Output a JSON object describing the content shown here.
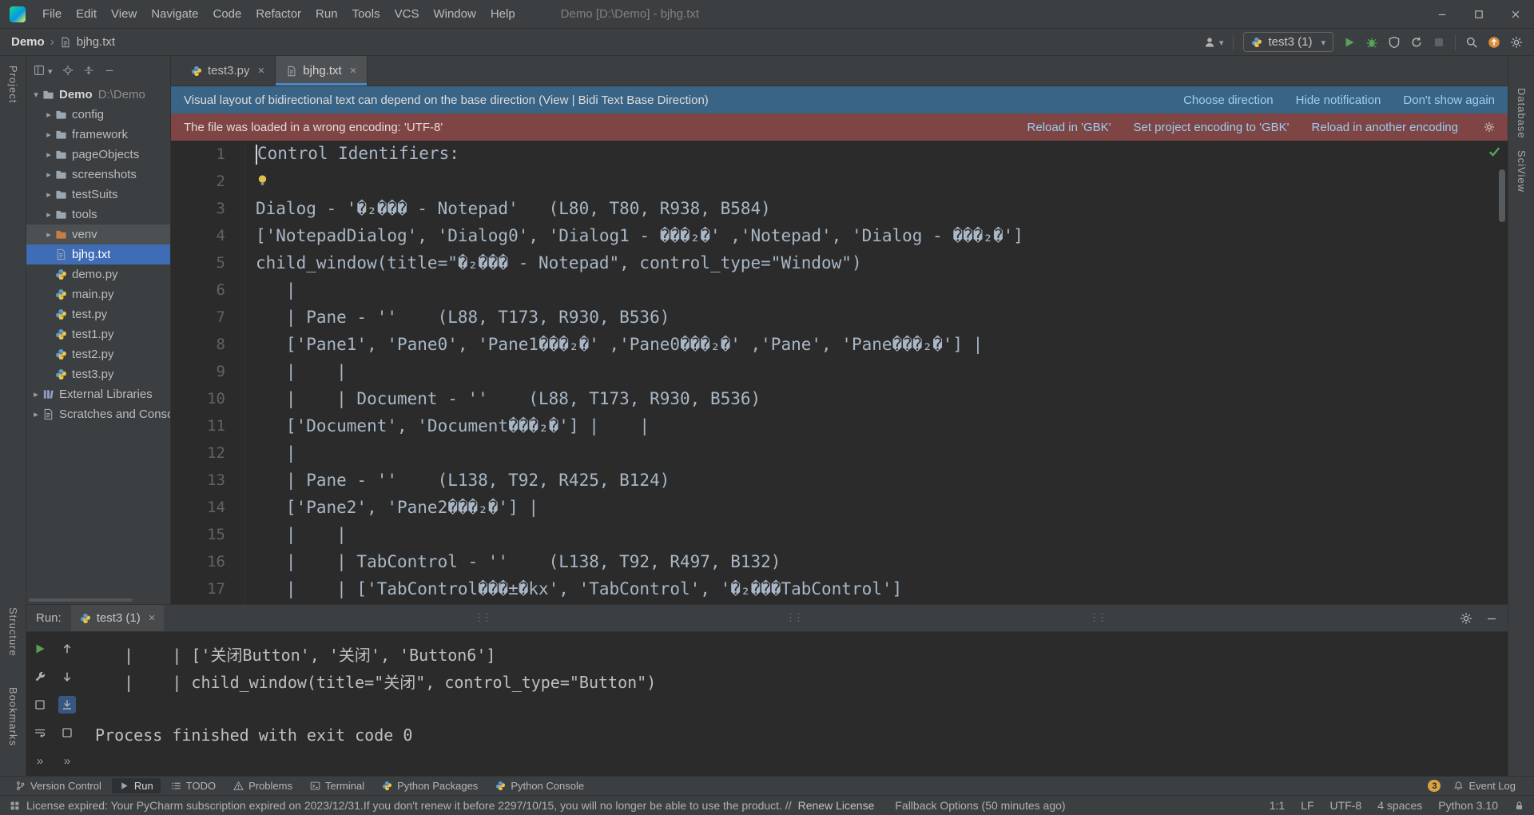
{
  "colors": {
    "accent": "#4a88c7",
    "link": "#9ccdf0",
    "info-bg": "#3a6486",
    "error-bg": "#7e4544",
    "selection": "#3f6db5",
    "green": "#58a158",
    "orange": "#d9a343"
  },
  "titlebar": {
    "menus": [
      "File",
      "Edit",
      "View",
      "Navigate",
      "Code",
      "Refactor",
      "Run",
      "Tools",
      "VCS",
      "Window",
      "Help"
    ],
    "title": "Demo [D:\\Demo] - bjhg.txt"
  },
  "navbar": {
    "crumb_project": "Demo",
    "crumb_file": "bjhg.txt",
    "run_config": "test3 (1)"
  },
  "strips": {
    "left": [
      "Project",
      "Structure",
      "Bookmarks"
    ],
    "right": [
      "Database",
      "SciView"
    ]
  },
  "project_panel": {
    "rows": [
      {
        "label": "Demo",
        "hint": "D:\\Demo"
      },
      {
        "label": "config"
      },
      {
        "label": "framework"
      },
      {
        "label": "pageObjects"
      },
      {
        "label": "screenshots"
      },
      {
        "label": "testSuits"
      },
      {
        "label": "tools"
      },
      {
        "label": "venv"
      },
      {
        "label": "bjhg.txt"
      },
      {
        "label": "demo.py"
      },
      {
        "label": "main.py"
      },
      {
        "label": "test.py"
      },
      {
        "label": "test1.py"
      },
      {
        "label": "test2.py"
      },
      {
        "label": "test3.py"
      },
      {
        "label": "External Libraries"
      },
      {
        "label": "Scratches and Consoles"
      }
    ]
  },
  "tabs": {
    "tab1": "test3.py",
    "tab2": "bjhg.txt"
  },
  "banner_info": {
    "text": "Visual layout of bidirectional text can depend on the base direction (View | Bidi Text Base Direction)",
    "link1": "Choose direction",
    "link2": "Hide notification",
    "link3": "Don't show again"
  },
  "banner_error": {
    "text": "The file was loaded in a wrong encoding: 'UTF-8'",
    "link1": "Reload in 'GBK'",
    "link2": "Set project encoding to 'GBK'",
    "link3": "Reload in another encoding"
  },
  "editor": {
    "lines": [
      {
        "n": "1",
        "t": "Control Identifiers:"
      },
      {
        "n": "2",
        "t": ""
      },
      {
        "n": "3",
        "t": "Dialog - '�₂��� - Notepad'   (L80, T80, R938, B584)"
      },
      {
        "n": "4",
        "t": "['NotepadDialog', 'Dialog0', 'Dialog1 - ���₂�' ,'Notepad', 'Dialog - ���₂�']"
      },
      {
        "n": "5",
        "t": "child_window(title=\"�₂��� - Notepad\", control_type=\"Window\")"
      },
      {
        "n": "6",
        "t": "   |"
      },
      {
        "n": "7",
        "t": "   | Pane - ''    (L88, T173, R930, B536)"
      },
      {
        "n": "8",
        "t": "   ['Pane1', 'Pane0', 'Pane1���₂�' ,'Pane0���₂�' ,'Pane', 'Pane���₂�'] |"
      },
      {
        "n": "9",
        "t": "   |    |"
      },
      {
        "n": "10",
        "t": "   |    | Document - ''    (L88, T173, R930, B536)"
      },
      {
        "n": "11",
        "t": "   ['Document', 'Document���₂�'] |    |"
      },
      {
        "n": "12",
        "t": "   |"
      },
      {
        "n": "13",
        "t": "   | Pane - ''    (L138, T92, R425, B124)"
      },
      {
        "n": "14",
        "t": "   ['Pane2', 'Pane2���₂�'] |"
      },
      {
        "n": "15",
        "t": "   |    |"
      },
      {
        "n": "16",
        "t": "   |    | TabControl - ''    (L138, T92, R497, B132)"
      },
      {
        "n": "17",
        "t": "   |    | ['TabControl���±�kx', 'TabControl', '�₂���TabControl']"
      }
    ]
  },
  "run_panel": {
    "label": "Run:",
    "tab": "test3 (1)",
    "console": [
      "   |    | ['关闭Button', '关闭', 'Button6']",
      "   |    | child_window(title=\"关闭\", control_type=\"Button\")",
      "",
      "Process finished with exit code 0"
    ]
  },
  "toolwindows": {
    "items": [
      {
        "label": "Version Control"
      },
      {
        "label": "Run"
      },
      {
        "label": "TODO"
      },
      {
        "label": "Problems"
      },
      {
        "label": "Terminal"
      },
      {
        "label": "Python Packages"
      },
      {
        "label": "Python Console"
      }
    ],
    "event_log": "Event Log",
    "event_badge": "3"
  },
  "statusbar": {
    "license_text": "License expired: Your PyCharm subscription expired on 2023/12/31.If you don't renew it before 2297/10/15, you will no longer be able to use the product. //",
    "renew_link": "Renew License",
    "fallback": "Fallback Options (50 minutes ago)",
    "caret": "1:1",
    "line_ending": "LF",
    "encoding": "UTF-8",
    "indent": "4 spaces",
    "interpreter": "Python 3.10"
  }
}
